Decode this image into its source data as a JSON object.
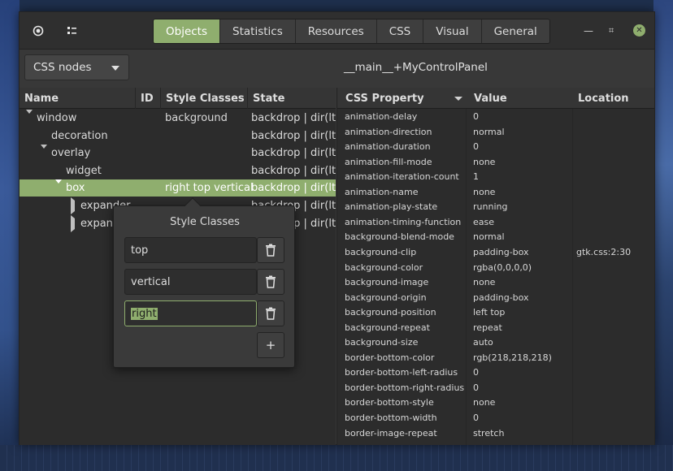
{
  "tabs": [
    {
      "label": "Objects",
      "active": true
    },
    {
      "label": "Statistics",
      "active": false
    },
    {
      "label": "Resources",
      "active": false
    },
    {
      "label": "CSS",
      "active": false
    },
    {
      "label": "Visual",
      "active": false
    },
    {
      "label": "General",
      "active": false
    }
  ],
  "toolbar": {
    "node_select_value": "CSS nodes",
    "object_title": "__main__+MyControlPanel"
  },
  "tree": {
    "columns": [
      "Name",
      "ID",
      "Style Classes",
      "State"
    ],
    "rows": [
      {
        "name": "window",
        "id": "",
        "classes": "background",
        "state": "backdrop | dir(ltr)",
        "depth": 0,
        "expander": "open",
        "selected": false
      },
      {
        "name": "decoration",
        "id": "",
        "classes": "",
        "state": "backdrop | dir(ltr)",
        "depth": 1,
        "expander": "none",
        "selected": false
      },
      {
        "name": "overlay",
        "id": "",
        "classes": "",
        "state": "backdrop | dir(ltr)",
        "depth": 1,
        "expander": "open",
        "selected": false
      },
      {
        "name": "widget",
        "id": "",
        "classes": "",
        "state": "backdrop | dir(ltr)",
        "depth": 2,
        "expander": "none",
        "selected": false
      },
      {
        "name": "box",
        "id": "",
        "classes": "right top vertical",
        "state": "backdrop | dir(ltr)",
        "depth": 2,
        "expander": "open",
        "selected": true
      },
      {
        "name": "expander",
        "id": "",
        "classes": "",
        "state": "backdrop | dir(ltr)",
        "depth": 3,
        "expander": "closed",
        "selected": false
      },
      {
        "name": "expander",
        "id": "",
        "classes": "",
        "state": "backdrop | dir(ltr)",
        "depth": 3,
        "expander": "closed",
        "selected": false
      }
    ]
  },
  "properties": {
    "columns": [
      "CSS Property",
      "Value",
      "Location"
    ],
    "rows": [
      {
        "property": "animation-delay",
        "value": "0",
        "location": ""
      },
      {
        "property": "animation-direction",
        "value": "normal",
        "location": ""
      },
      {
        "property": "animation-duration",
        "value": "0",
        "location": ""
      },
      {
        "property": "animation-fill-mode",
        "value": "none",
        "location": ""
      },
      {
        "property": "animation-iteration-count",
        "value": "1",
        "location": ""
      },
      {
        "property": "animation-name",
        "value": "none",
        "location": ""
      },
      {
        "property": "animation-play-state",
        "value": "running",
        "location": ""
      },
      {
        "property": "animation-timing-function",
        "value": "ease",
        "location": ""
      },
      {
        "property": "background-blend-mode",
        "value": "normal",
        "location": ""
      },
      {
        "property": "background-clip",
        "value": "padding-box",
        "location": "gtk.css:2:30"
      },
      {
        "property": "background-color",
        "value": "rgba(0,0,0,0)",
        "location": ""
      },
      {
        "property": "background-image",
        "value": "none",
        "location": ""
      },
      {
        "property": "background-origin",
        "value": "padding-box",
        "location": ""
      },
      {
        "property": "background-position",
        "value": "left top",
        "location": ""
      },
      {
        "property": "background-repeat",
        "value": "repeat",
        "location": ""
      },
      {
        "property": "background-size",
        "value": "auto",
        "location": ""
      },
      {
        "property": "border-bottom-color",
        "value": "rgb(218,218,218)",
        "location": ""
      },
      {
        "property": "border-bottom-left-radius",
        "value": "0",
        "location": ""
      },
      {
        "property": "border-bottom-right-radius",
        "value": "0",
        "location": ""
      },
      {
        "property": "border-bottom-style",
        "value": "none",
        "location": ""
      },
      {
        "property": "border-bottom-width",
        "value": "0",
        "location": ""
      },
      {
        "property": "border-image-repeat",
        "value": "stretch",
        "location": ""
      }
    ]
  },
  "popover": {
    "title": "Style Classes",
    "classes": [
      {
        "value": "top",
        "focused": false
      },
      {
        "value": "vertical",
        "focused": false
      },
      {
        "value": "right",
        "focused": true
      }
    ],
    "add_label": "+"
  },
  "colors": {
    "accent": "#8fae6e",
    "window_bg": "#383838",
    "pane_bg": "#2c2c2c"
  },
  "icons": {
    "app_menu": "target-icon",
    "view_toggle": "list-icon",
    "delete": "trash-icon",
    "minimize": "minimize-icon",
    "maximize": "maximize-icon",
    "close": "close-icon"
  }
}
